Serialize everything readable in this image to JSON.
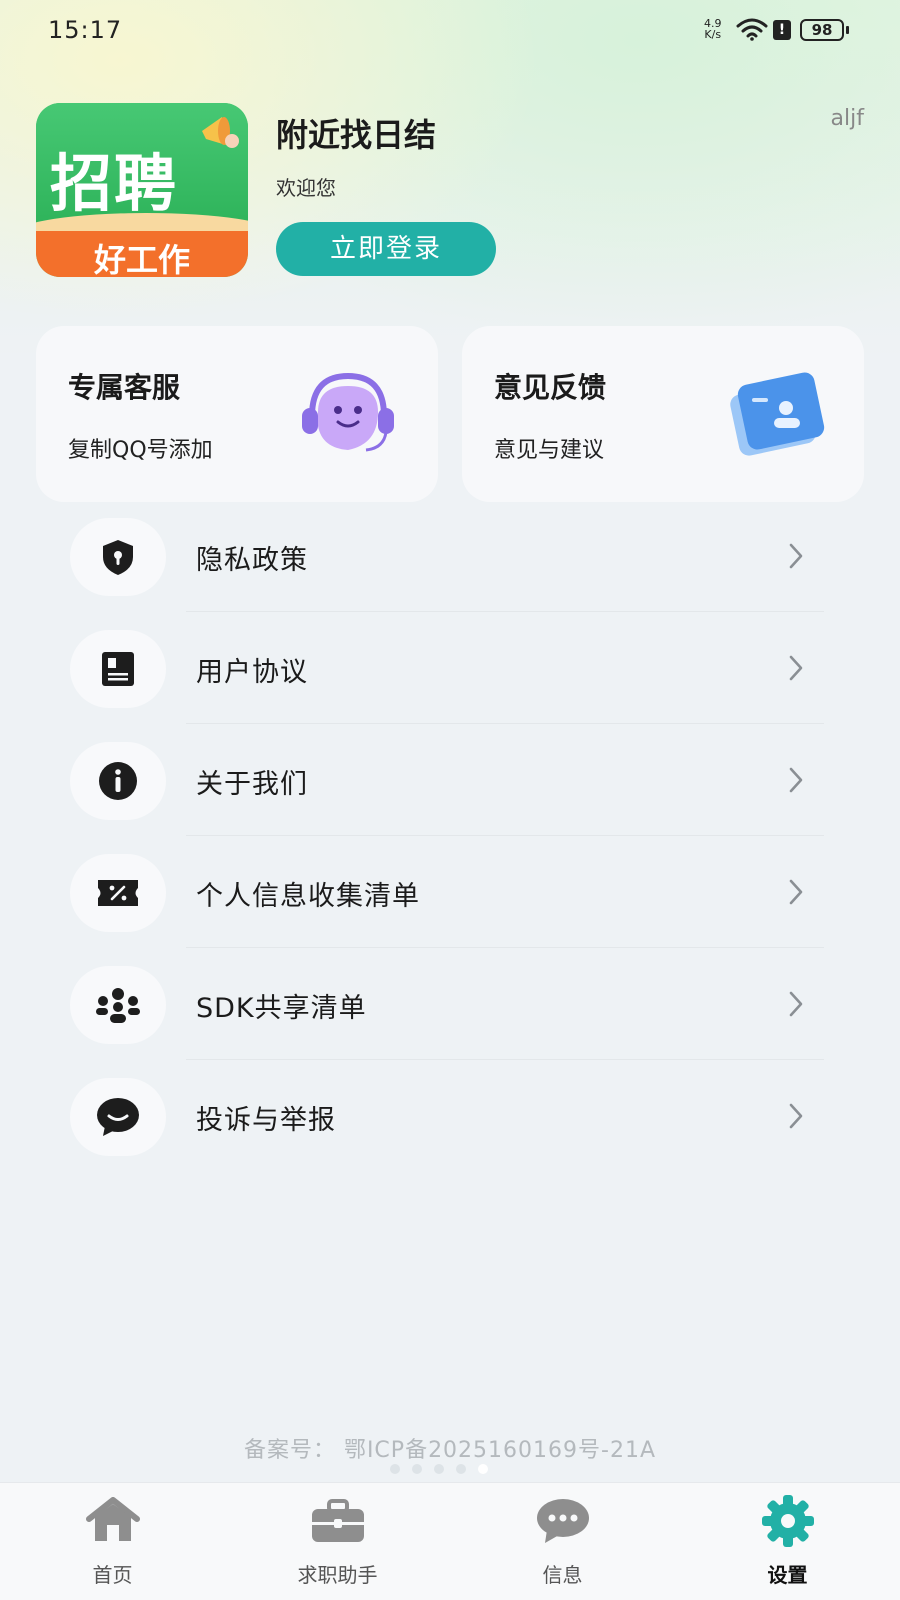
{
  "status_bar": {
    "time": "15:17",
    "net_speed_value": "4.9",
    "net_speed_unit": "K/s",
    "battery": "98",
    "alert_glyph": "!"
  },
  "header": {
    "app_name": "附近找日结",
    "welcome": "欢迎您",
    "login_label": "立即登录",
    "top_right_tag": "aljf",
    "logo": {
      "main_text": "招聘",
      "sub_text": "好工作"
    }
  },
  "cards": [
    {
      "title": "专属客服",
      "subtitle": "复制QQ号添加",
      "icon": "customer-service-headset-icon"
    },
    {
      "title": "意见反馈",
      "subtitle": "意见与建议",
      "icon": "feedback-document-icon"
    }
  ],
  "menu": [
    {
      "label": "隐私政策",
      "icon": "shield-lock-icon"
    },
    {
      "label": "用户协议",
      "icon": "agreement-document-icon"
    },
    {
      "label": "关于我们",
      "icon": "info-icon"
    },
    {
      "label": "个人信息收集清单",
      "icon": "ticket-percent-icon"
    },
    {
      "label": "SDK共享清单",
      "icon": "group-people-icon"
    },
    {
      "label": "投诉与举报",
      "icon": "chat-bubble-icon"
    }
  ],
  "footer": {
    "icp": "备案号：  鄂ICP备2025160169号-21A"
  },
  "tabs": [
    {
      "label": "首页",
      "icon": "home-icon",
      "active": false
    },
    {
      "label": "求职助手",
      "icon": "briefcase-icon",
      "active": false
    },
    {
      "label": "信息",
      "icon": "message-bubble-icon",
      "active": false
    },
    {
      "label": "设置",
      "icon": "settings-gear-icon",
      "active": true
    }
  ],
  "colors": {
    "accent": "#22b0a6",
    "active_tab_icon": "#22b0a6",
    "logo_green": "#3ec168",
    "logo_orange": "#f3702b"
  }
}
